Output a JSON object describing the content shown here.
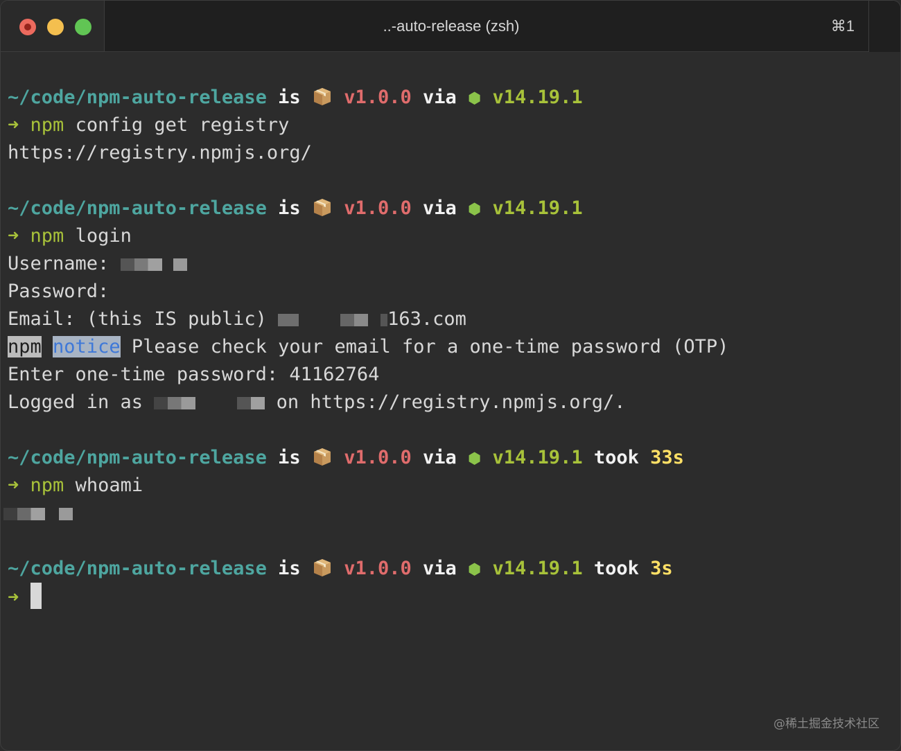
{
  "window": {
    "title": "..-auto-release (zsh)",
    "shortcut": "⌘1"
  },
  "prompt": {
    "path": "~/code/npm-auto-release",
    "is": "is",
    "version": "v1.0.0",
    "via": "via",
    "node": "v14.19.1",
    "took": "took",
    "arrow": "➜",
    "package_icon": "package-icon",
    "node_icon": "hexagon-icon"
  },
  "blocks": {
    "b1": {
      "cmd": "npm",
      "args": " config get registry",
      "output": "https://registry.npmjs.org/"
    },
    "b2": {
      "cmd": "npm",
      "args": " login",
      "username_label": "Username:",
      "password_label": "Password:",
      "email_label": "Email: (this IS public) ",
      "email_tail": "163.com",
      "notice_npm": "npm",
      "notice_word": "notice",
      "notice_text": " Please check your email for a one-time password (OTP)",
      "otp_line": "Enter one-time password: 41162764",
      "logged_prefix": "Logged in as ",
      "logged_suffix": "on https://registry.npmjs.org/."
    },
    "b3": {
      "duration": "33s",
      "cmd": "npm",
      "args": " whoami"
    },
    "b4": {
      "duration": "3s"
    }
  },
  "watermark": "@稀土掘金技术社区",
  "colors": {
    "path": "#4ea6a0",
    "version": "#e06c6c",
    "node": "#a8c23a",
    "duration": "#ffe066",
    "background": "#2c2c2c"
  }
}
